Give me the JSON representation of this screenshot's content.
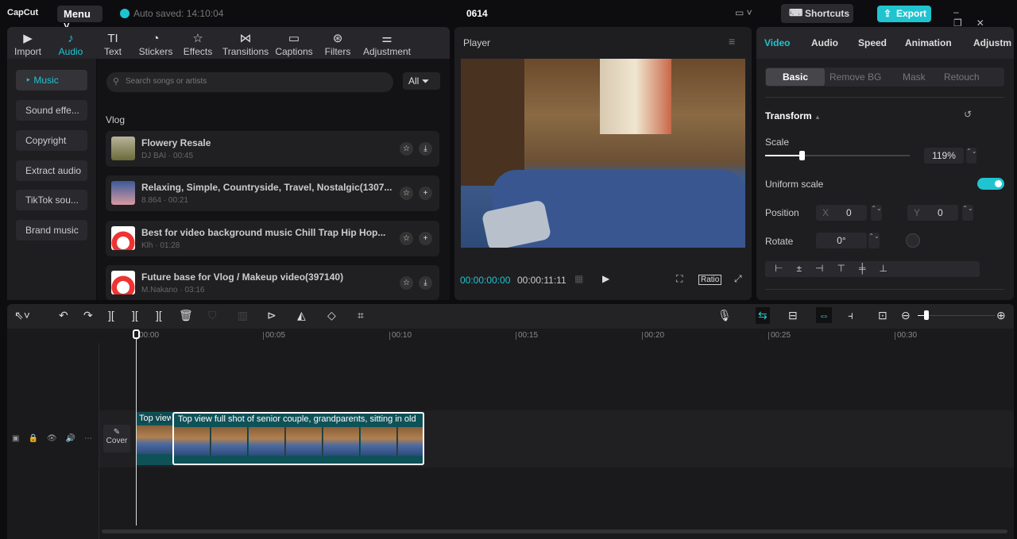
{
  "app": {
    "logo": "CapCut",
    "menu": "Menu",
    "autosave": "Auto saved: 14:10:04",
    "project": "0614",
    "shortcuts": "Shortcuts",
    "export": "Export"
  },
  "toptabs": [
    {
      "label": "Import",
      "icon": "▶"
    },
    {
      "label": "Audio",
      "icon": "♪"
    },
    {
      "label": "Text",
      "icon": "TI"
    },
    {
      "label": "Stickers",
      "icon": "◔"
    },
    {
      "label": "Effects",
      "icon": "☆"
    },
    {
      "label": "Transitions",
      "icon": "⋈"
    },
    {
      "label": "Captions",
      "icon": "▭"
    },
    {
      "label": "Filters",
      "icon": "⊛"
    },
    {
      "label": "Adjustment",
      "icon": "⚌"
    }
  ],
  "sidebar": [
    "Music",
    "Sound effe...",
    "Copyright",
    "Extract audio",
    "TikTok sou...",
    "Brand music"
  ],
  "library": {
    "search_placeholder": "Search songs or artists",
    "filter": "All",
    "section": "Vlog",
    "songs": [
      {
        "title": "Flowery Resale",
        "sub": "DJ BAI · 00:45",
        "action": "download"
      },
      {
        "title": "Relaxing, Simple, Countryside, Travel, Nostalgic(1307...",
        "sub": "8.864 · 00:21",
        "action": "add"
      },
      {
        "title": "Best for video background music Chill Trap Hip Hop...",
        "sub": "Klh · 01:28",
        "action": "add"
      },
      {
        "title": "Future base for Vlog / Makeup video(397140)",
        "sub": "M.Nakano · 03:16",
        "action": "download"
      }
    ]
  },
  "player": {
    "title": "Player",
    "current": "00:00:00:00",
    "total": "00:00:11:11",
    "ratio": "Ratio"
  },
  "inspector": {
    "tabs": [
      "Video",
      "Audio",
      "Speed",
      "Animation",
      "Adjustm"
    ],
    "subtabs": [
      "Basic",
      "Remove BG",
      "Mask",
      "Retouch"
    ],
    "section": "Transform",
    "scale_label": "Scale",
    "scale_value": "119%",
    "scale_fraction": 0.25,
    "uniform": "Uniform scale",
    "uniform_on": true,
    "position_label": "Position",
    "x_label": "X",
    "x": "0",
    "y_label": "Y",
    "y": "0",
    "rotate_label": "Rotate",
    "rotate": "0°"
  },
  "timeline": {
    "ticks": [
      "00:00",
      "00:05",
      "00:10",
      "00:15",
      "00:20",
      "00:25",
      "00:30"
    ],
    "cover": "Cover",
    "clip_short": "Top view",
    "clip_title": "Top view full shot of senior couple, grandparents, sitting in old"
  },
  "colors": {
    "accent": "#1fc4d0"
  }
}
